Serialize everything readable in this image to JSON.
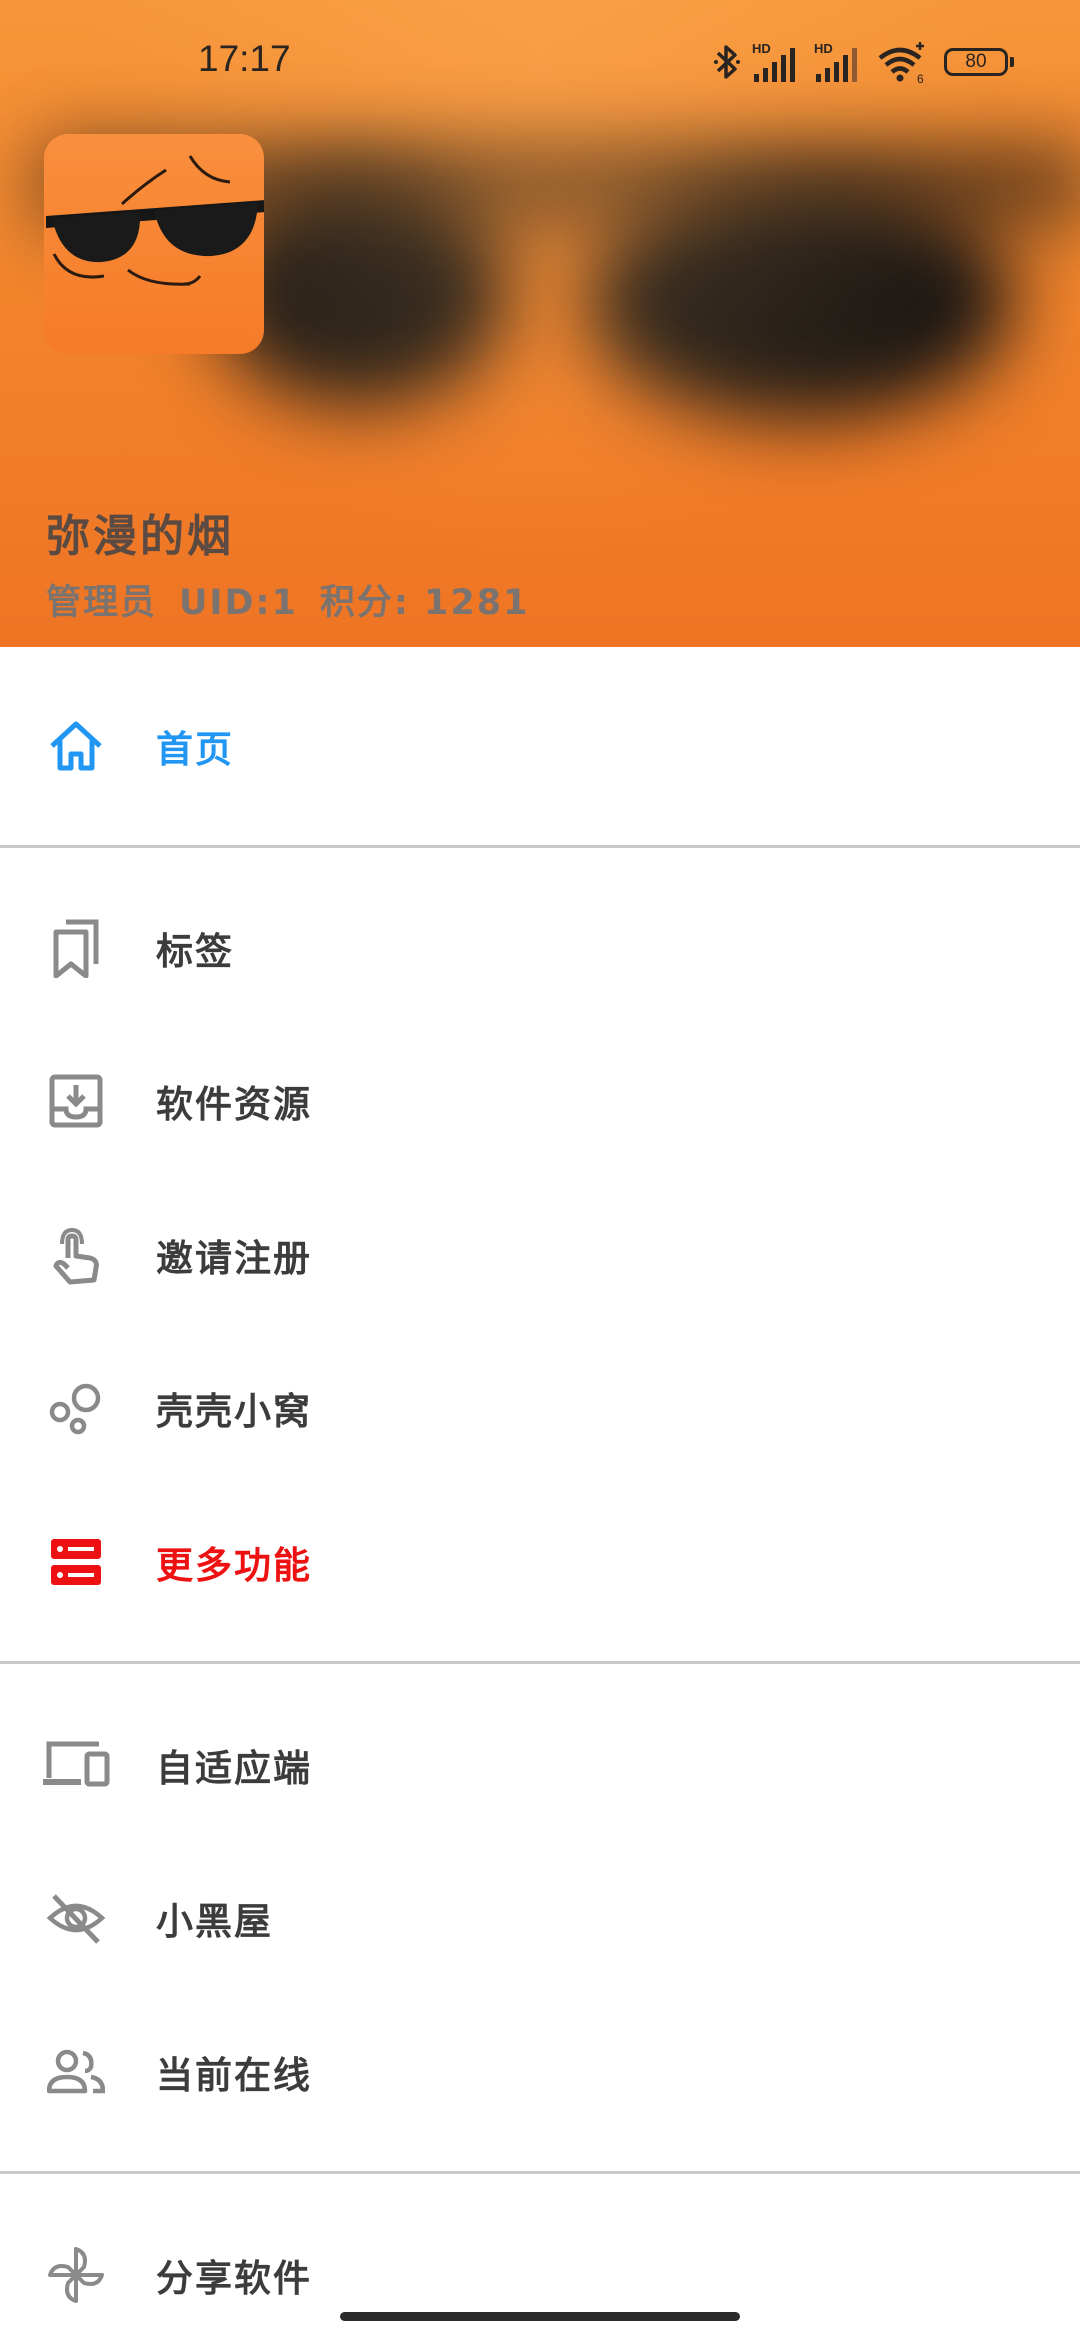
{
  "status_bar": {
    "time": "17:17",
    "battery": "80",
    "icons": [
      "bluetooth-icon",
      "signal-hd-icon",
      "signal-hd-icon",
      "wifi-icon"
    ]
  },
  "profile": {
    "name": "弥漫的烟",
    "role": "管理员",
    "uid": "UID:1",
    "points": "积分: 1281"
  },
  "menu": {
    "home": {
      "label": "首页",
      "icon": "home-icon"
    },
    "tags": {
      "label": "标签",
      "icon": "bookmark-icon"
    },
    "software": {
      "label": "软件资源",
      "icon": "download-tray-icon"
    },
    "invite": {
      "label": "邀请注册",
      "icon": "touch-hand-icon"
    },
    "nest": {
      "label": "壳壳小窝",
      "icon": "bubbles-icon"
    },
    "more": {
      "label": "更多功能",
      "icon": "server-icon"
    },
    "adaptive": {
      "label": "自适应端",
      "icon": "devices-icon"
    },
    "blackroom": {
      "label": "小黑屋",
      "icon": "eye-off-icon"
    },
    "online": {
      "label": "当前在线",
      "icon": "people-icon"
    },
    "share": {
      "label": "分享软件",
      "icon": "pinwheel-icon"
    }
  },
  "colors": {
    "header_orange": "#f2842c",
    "active_blue": "#2196f3",
    "alert_red": "#ee1111",
    "icon_gray": "#8a8a8a"
  }
}
